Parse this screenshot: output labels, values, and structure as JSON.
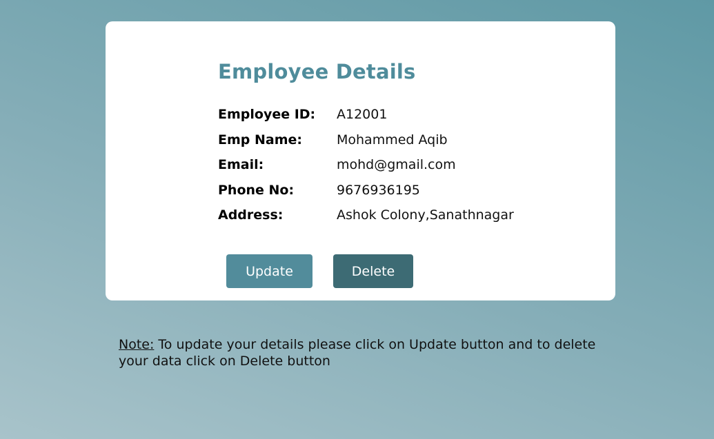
{
  "card": {
    "title": "Employee Details",
    "fields": [
      {
        "label": "Employee ID:",
        "value": "A12001"
      },
      {
        "label": "Emp Name:",
        "value": "Mohammed Aqib"
      },
      {
        "label": "Email:",
        "value": "mohd@gmail.com"
      },
      {
        "label": "Phone No:",
        "value": "9676936195"
      },
      {
        "label": "Address:",
        "value": "Ashok Colony,Sanathnagar"
      }
    ],
    "update_label": "Update",
    "delete_label": "Delete"
  },
  "note": {
    "label": "Note:",
    "text": " To update your details please click on Update button and to delete your data click on Delete button"
  },
  "colors": {
    "title": "#4f8c9b",
    "update_button": "#528c9b",
    "delete_button": "#3d6b74"
  }
}
